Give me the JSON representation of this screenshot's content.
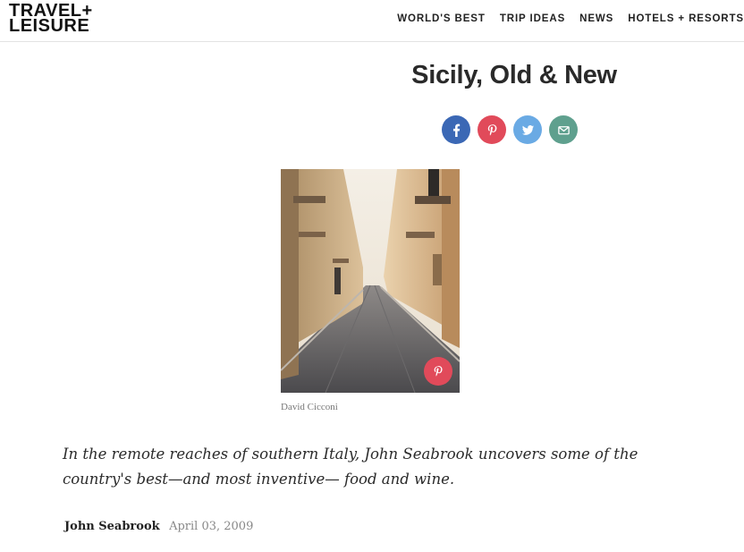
{
  "brand": {
    "logo_line1": "TRAVEL+",
    "logo_line2": "LEISURE"
  },
  "nav": [
    {
      "label": "WORLD'S BEST"
    },
    {
      "label": "TRIP IDEAS"
    },
    {
      "label": "NEWS"
    },
    {
      "label": "HOTELS + RESORTS"
    }
  ],
  "article": {
    "title": "Sicily, Old & New",
    "share": [
      {
        "network": "facebook",
        "icon": "facebook-icon",
        "color": "#3b68b5"
      },
      {
        "network": "pinterest",
        "icon": "pinterest-icon",
        "color": "#e14a5a"
      },
      {
        "network": "twitter",
        "icon": "twitter-icon",
        "color": "#6aaae4"
      },
      {
        "network": "email",
        "icon": "mail-icon",
        "color": "#5fa08e"
      }
    ],
    "image_credit": "David Cicconi",
    "dek": "In the remote reaches of southern Italy, John Seabrook uncovers some of the country's best—and most inventive— food and wine.",
    "author": "John Seabrook",
    "date": "April 03, 2009"
  }
}
